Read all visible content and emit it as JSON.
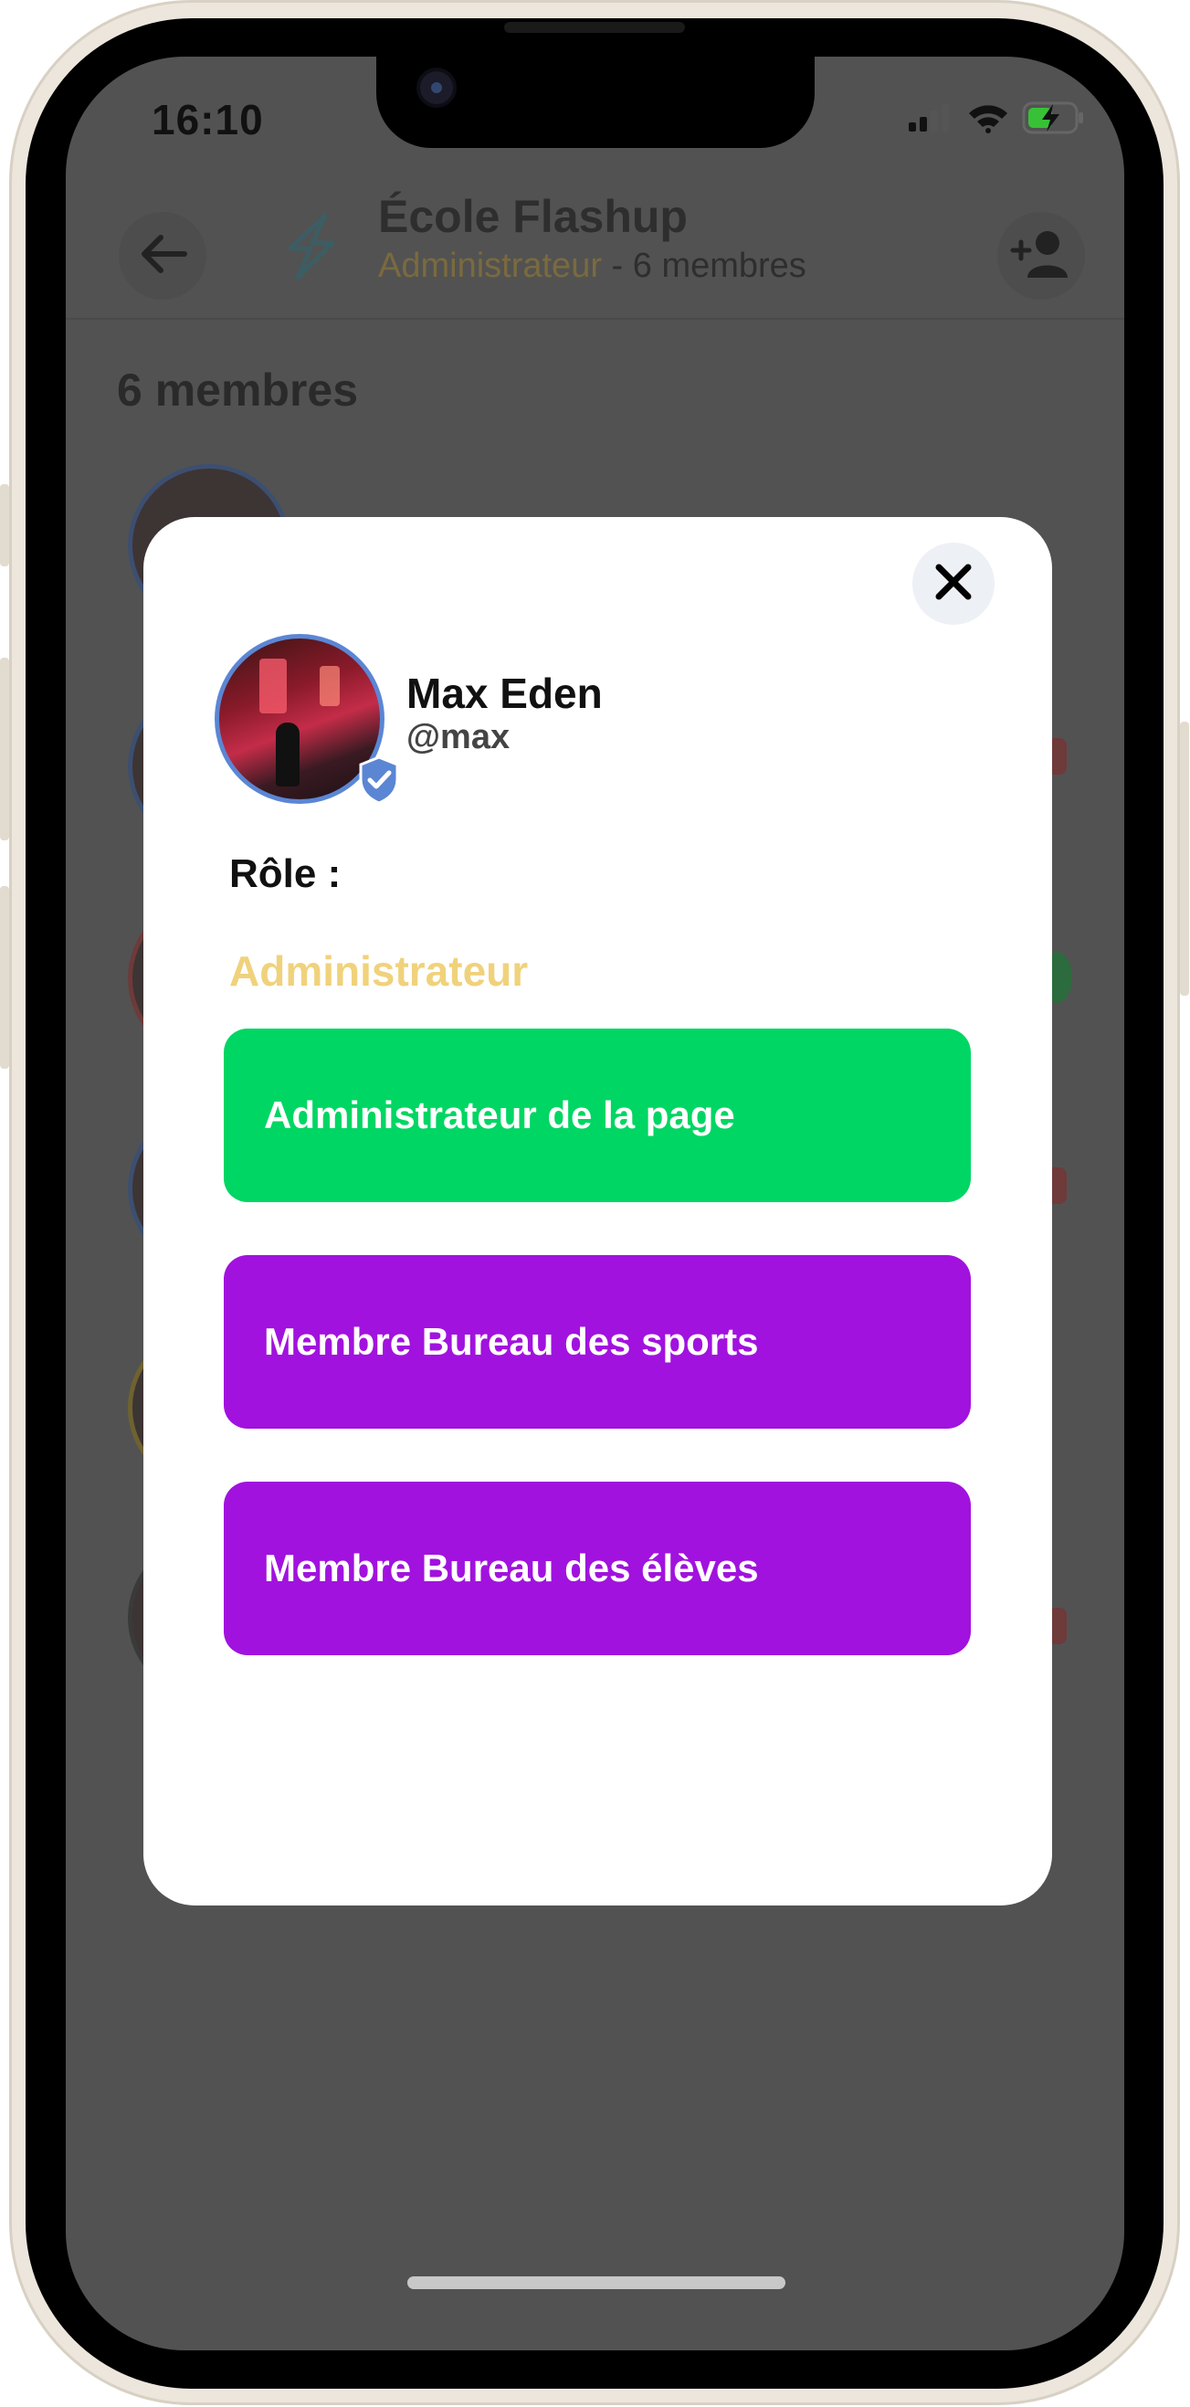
{
  "status_bar": {
    "time": "16:10",
    "battery_color": "#38c136"
  },
  "header": {
    "title": "École Flashup",
    "role": "Administrateur",
    "members_summary": " - 6 membres"
  },
  "members": {
    "count_label": "6 membres"
  },
  "modal": {
    "user": {
      "name": "Max Eden",
      "handle": "@max"
    },
    "role_label": "Rôle :",
    "current_role": "Administrateur",
    "role_buttons": [
      {
        "label": "Administrateur de la page",
        "color": "#00d663"
      },
      {
        "label": "Membre Bureau des sports",
        "color": "#a112de"
      },
      {
        "label": "Membre Bureau des élèves",
        "color": "#a112de"
      }
    ]
  },
  "colors": {
    "overlay": "#525252",
    "role_accent": "#f0d27c",
    "verified": "#5b86d4"
  }
}
